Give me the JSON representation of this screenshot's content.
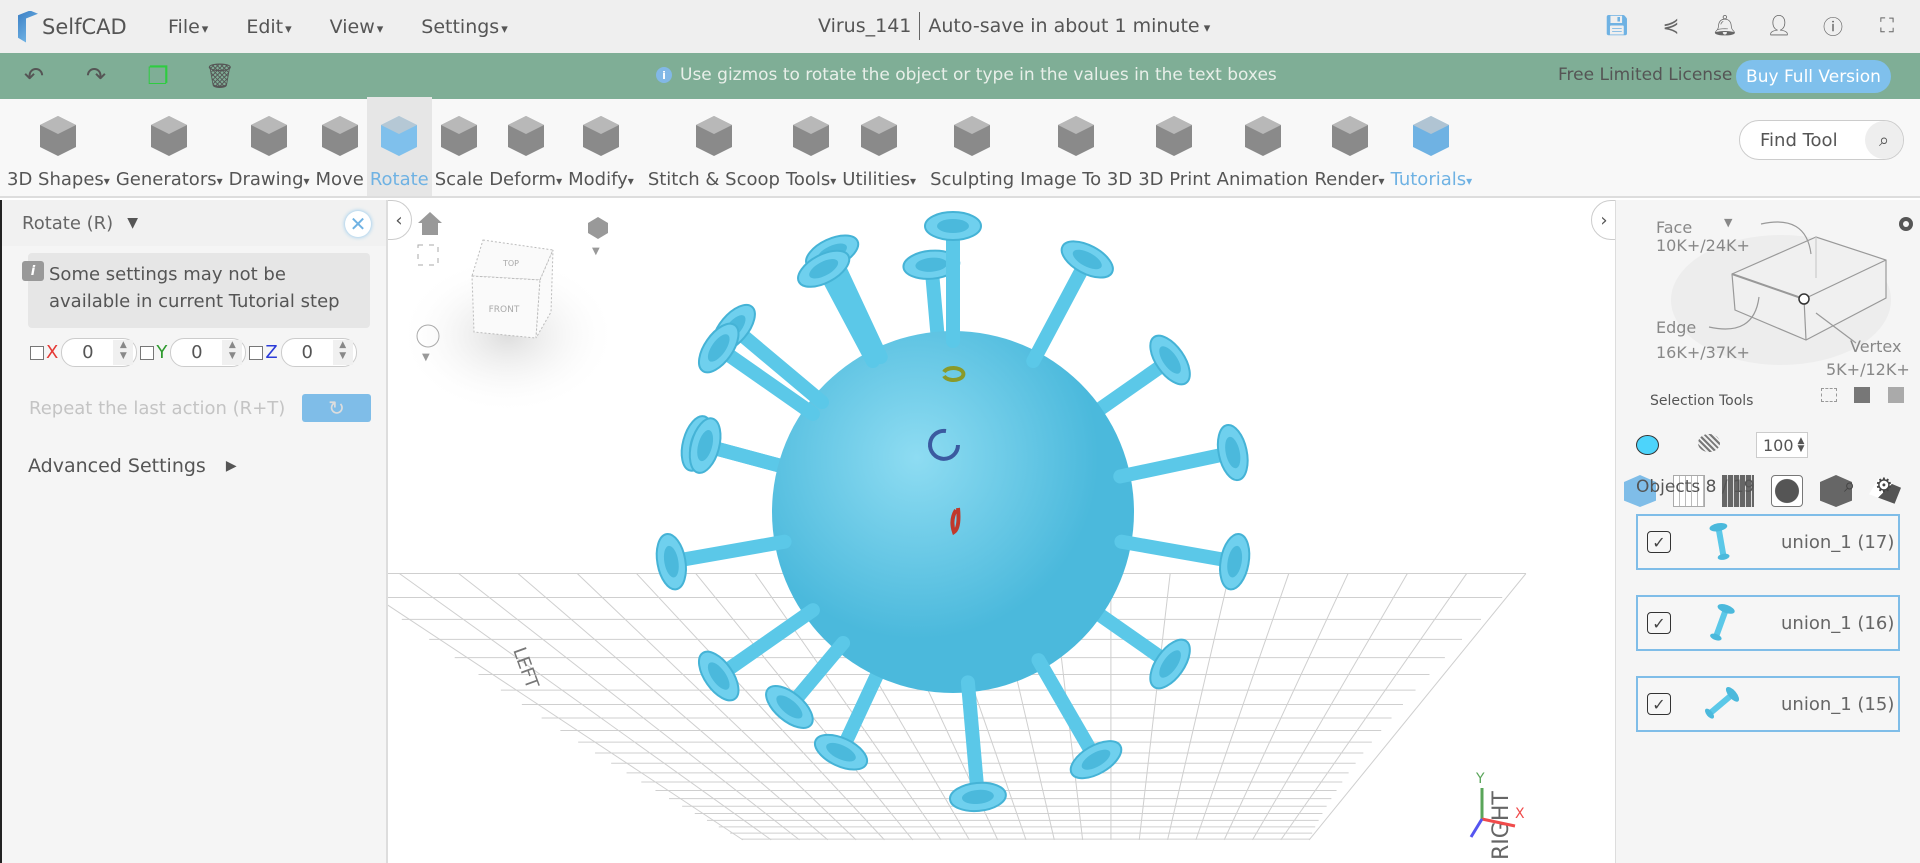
{
  "app": {
    "name": "SelfCAD"
  },
  "menu": [
    "File",
    "Edit",
    "View",
    "Settings"
  ],
  "document": {
    "title": "Virus_141",
    "autosave": "Auto-save in about 1 minute"
  },
  "top_icons": [
    "save-icon",
    "share-icon",
    "bell-icon",
    "user-icon",
    "info-icon",
    "fullscreen-icon"
  ],
  "hint_bar": {
    "message": "Use gizmos to rotate the object or type in the values in the text boxes",
    "license": "Free Limited License",
    "buy": "Buy Full Version"
  },
  "toolbar": [
    {
      "label": "3D Shapes",
      "drop": true
    },
    {
      "label": "Generators",
      "drop": true
    },
    {
      "label": "Drawing",
      "drop": true
    },
    {
      "label": "Move"
    },
    {
      "label": "Rotate",
      "active": true
    },
    {
      "label": "Scale"
    },
    {
      "label": "Deform",
      "drop": true
    },
    {
      "label": "Modify",
      "drop": true
    },
    {
      "label": "Stitch & Scoop"
    },
    {
      "label": "Tools",
      "drop": true
    },
    {
      "label": "Utilities",
      "drop": true
    },
    {
      "label": "Sculpting"
    },
    {
      "label": "Image To 3D"
    },
    {
      "label": "3D Print"
    },
    {
      "label": "Animation"
    },
    {
      "label": "Render",
      "drop": true
    },
    {
      "label": "Tutorials",
      "drop": true
    }
  ],
  "find_tool": {
    "placeholder": "Find Tool"
  },
  "left_panel": {
    "title": "Rotate (R)",
    "notice": "Some settings may not be available in current Tutorial step",
    "axes": [
      {
        "label": "X",
        "value": "0",
        "color": "#e53935"
      },
      {
        "label": "Y",
        "value": "0",
        "color": "#2e9a2e"
      },
      {
        "label": "Z",
        "value": "0",
        "color": "#2b3bd8"
      }
    ],
    "repeat": "Repeat the last action (R+T)",
    "advanced": "Advanced Settings"
  },
  "viewport": {
    "cube_top": "TOP",
    "cube_front": "FRONT",
    "label_left": "LEFT",
    "label_right": "RIGHT",
    "axis_x": "X",
    "axis_y": "Y",
    "model_color": "#5bc8e8"
  },
  "right_panel": {
    "face": "Face",
    "face_count": "10K+/24K+",
    "edge": "Edge",
    "edge_count": "16K+/37K+",
    "vertex": "Vertex",
    "vertex_count": "5K+/12K+",
    "selection_tools": "Selection Tools",
    "opacity": "100",
    "color": "#4dd4fb",
    "objects": "Objects 8 / 19",
    "items": [
      {
        "name": "union_1 (17)",
        "checked": true
      },
      {
        "name": "union_1 (16)",
        "checked": true
      },
      {
        "name": "union_1 (15)",
        "checked": true
      }
    ]
  }
}
